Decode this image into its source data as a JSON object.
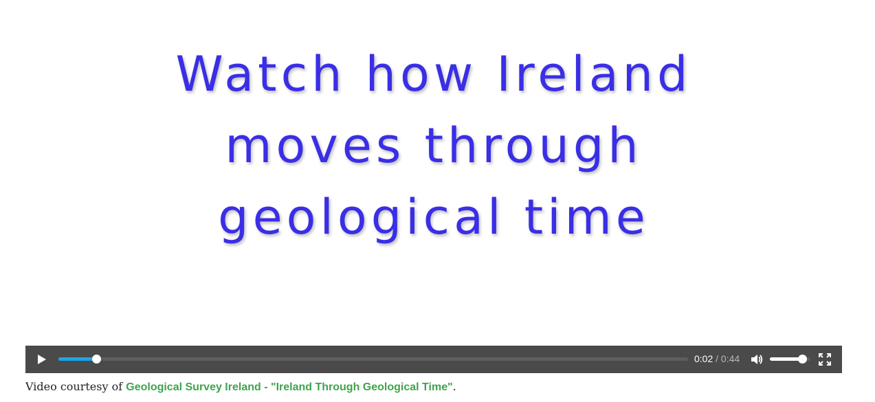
{
  "video": {
    "title_lines": [
      "Watch how Ireland",
      "moves through",
      "geological time"
    ],
    "progress_fraction": 0.06,
    "volume_fraction": 0.8
  },
  "controls": {
    "play_icon": "play-icon",
    "current_time": "0:02",
    "separator": "/",
    "duration": "0:44",
    "volume_icon": "volume-icon",
    "fullscreen_icon": "fullscreen-icon",
    "accent_color": "#1ba6e8",
    "bar_color": "#4a4a4a"
  },
  "caption": {
    "prefix": "Video courtesy of ",
    "link_text": "Geological Survey Ireland - \"Ireland Through Geological Time\"",
    "suffix": ".",
    "link_color": "#3fa34d"
  }
}
